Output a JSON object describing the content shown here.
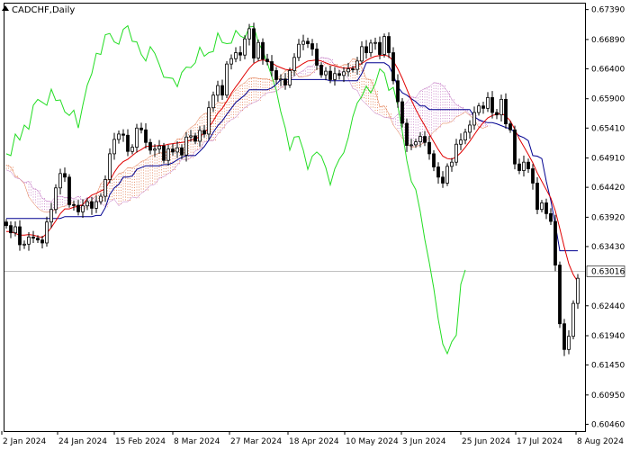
{
  "title": "CADCHF,Daily",
  "current_price": "0.63016",
  "colors": {
    "background": "#ffffff",
    "axis": "#000000",
    "candle": "#000000",
    "tenkan": "#e00000",
    "kijun": "#000090",
    "chikou": "#22dd22",
    "kumo_bull": "#e07040",
    "kumo_bear": "#c070c0",
    "price_line": "#c0c0c0"
  },
  "chart_data": {
    "type": "candlestick",
    "indicator": "Ichimoku Kinko Hyo",
    "symbol": "CADCHF",
    "timeframe": "Daily",
    "y_ticks": [
      "0.67390",
      "0.66890",
      "0.66400",
      "0.65900",
      "0.65410",
      "0.64910",
      "0.64420",
      "0.63920",
      "0.63430",
      "0.62440",
      "0.61940",
      "0.61450",
      "0.60950",
      "0.60460"
    ],
    "x_ticks": [
      "2 Jan 2024",
      "24 Jan 2024",
      "15 Feb 2024",
      "8 Mar 2024",
      "27 Mar 2024",
      "18 Apr 2024",
      "10 May 2024",
      "3 Jun 2024",
      "25 Jun 2024",
      "17 Jul 2024",
      "8 Aug 2024"
    ],
    "ylim": [
      0.60346,
      0.6749
    ],
    "price_line": 0.63016,
    "close": [
      0.6378,
      0.6366,
      0.6376,
      0.6346,
      0.6347,
      0.6359,
      0.6357,
      0.6354,
      0.6349,
      0.6384,
      0.6405,
      0.6441,
      0.6465,
      0.6459,
      0.6413,
      0.6412,
      0.6401,
      0.6411,
      0.6418,
      0.6407,
      0.6418,
      0.6427,
      0.6455,
      0.6498,
      0.6522,
      0.6531,
      0.6529,
      0.6502,
      0.6509,
      0.6541,
      0.6538,
      0.6517,
      0.6504,
      0.6506,
      0.6511,
      0.6487,
      0.6506,
      0.6501,
      0.6508,
      0.6496,
      0.6526,
      0.6528,
      0.6519,
      0.6537,
      0.6531,
      0.6575,
      0.6596,
      0.6612,
      0.6596,
      0.6648,
      0.6657,
      0.6667,
      0.6663,
      0.669,
      0.6707,
      0.6658,
      0.6684,
      0.6656,
      0.6652,
      0.6637,
      0.6622,
      0.6623,
      0.6613,
      0.6637,
      0.6659,
      0.6681,
      0.6686,
      0.6682,
      0.6673,
      0.6646,
      0.663,
      0.6636,
      0.6622,
      0.6632,
      0.6629,
      0.6635,
      0.664,
      0.6639,
      0.6653,
      0.6677,
      0.6667,
      0.6683,
      0.6684,
      0.6664,
      0.6694,
      0.6667,
      0.662,
      0.6585,
      0.6549,
      0.6512,
      0.6513,
      0.6518,
      0.6527,
      0.6517,
      0.6498,
      0.6476,
      0.6459,
      0.6449,
      0.6477,
      0.6484,
      0.6514,
      0.6521,
      0.6534,
      0.6546,
      0.6567,
      0.6578,
      0.6574,
      0.6592,
      0.6567,
      0.6563,
      0.6589,
      0.6548,
      0.6538,
      0.6481,
      0.647,
      0.6484,
      0.6473,
      0.6449,
      0.6405,
      0.6416,
      0.6398,
      0.6385,
      0.6312,
      0.6214,
      0.6171,
      0.6193,
      0.6248,
      0.629
    ],
    "tenkan_sen": [
      0.6368,
      0.6368,
      0.6365,
      0.6362,
      0.6362,
      0.6363,
      0.6362,
      0.636,
      0.6358,
      0.6365,
      0.6375,
      0.6386,
      0.6398,
      0.6406,
      0.6406,
      0.6409,
      0.641,
      0.6413,
      0.6423,
      0.6429,
      0.6432,
      0.6436,
      0.6439,
      0.6453,
      0.6467,
      0.6478,
      0.6485,
      0.6489,
      0.6495,
      0.6501,
      0.6505,
      0.651,
      0.6511,
      0.6511,
      0.6512,
      0.6512,
      0.6514,
      0.6515,
      0.6516,
      0.6517,
      0.6518,
      0.6521,
      0.6523,
      0.6527,
      0.6532,
      0.6542,
      0.6553,
      0.6566,
      0.6574,
      0.6586,
      0.6599,
      0.661,
      0.662,
      0.6631,
      0.6641,
      0.6649,
      0.6653,
      0.6655,
      0.6653,
      0.665,
      0.6645,
      0.6642,
      0.6639,
      0.6638,
      0.664,
      0.6644,
      0.6649,
      0.6653,
      0.6654,
      0.6655,
      0.6653,
      0.665,
      0.6647,
      0.6645,
      0.6643,
      0.6641,
      0.6641,
      0.6642,
      0.6645,
      0.6649,
      0.6654,
      0.6658,
      0.6661,
      0.6662,
      0.6663,
      0.6661,
      0.6653,
      0.664,
      0.6624,
      0.6606,
      0.6588,
      0.6572,
      0.6558,
      0.6545,
      0.6531,
      0.6518,
      0.6505,
      0.6494,
      0.649,
      0.6489,
      0.6493,
      0.65,
      0.6509,
      0.6519,
      0.653,
      0.6541,
      0.655,
      0.6558,
      0.6562,
      0.6564,
      0.6566,
      0.6561,
      0.6553,
      0.6539,
      0.6523,
      0.651,
      0.6497,
      0.6483,
      0.6466,
      0.6452,
      0.6438,
      0.6424,
      0.6403,
      0.6373,
      0.6342,
      0.6314,
      0.6296,
      0.6284
    ],
    "kijun_sen": [
      0.639,
      0.639,
      0.639,
      0.639,
      0.639,
      0.639,
      0.639,
      0.639,
      0.639,
      0.639,
      0.639,
      0.639,
      0.639,
      0.6393,
      0.6393,
      0.6393,
      0.6393,
      0.6393,
      0.6393,
      0.6393,
      0.6395,
      0.6395,
      0.6408,
      0.643,
      0.6441,
      0.6447,
      0.6459,
      0.6459,
      0.6461,
      0.6472,
      0.6475,
      0.6478,
      0.6478,
      0.6478,
      0.6478,
      0.648,
      0.648,
      0.6483,
      0.6488,
      0.6492,
      0.6495,
      0.6495,
      0.6495,
      0.6502,
      0.651,
      0.6521,
      0.6534,
      0.6545,
      0.6553,
      0.6564,
      0.6574,
      0.6584,
      0.659,
      0.6596,
      0.6605,
      0.6605,
      0.6605,
      0.6605,
      0.6605,
      0.6608,
      0.6614,
      0.6622,
      0.6622,
      0.6622,
      0.6622,
      0.6622,
      0.6622,
      0.6622,
      0.6622,
      0.6622,
      0.6622,
      0.6622,
      0.662,
      0.662,
      0.662,
      0.662,
      0.662,
      0.662,
      0.662,
      0.6632,
      0.665,
      0.665,
      0.665,
      0.665,
      0.665,
      0.6645,
      0.663,
      0.661,
      0.66,
      0.6596,
      0.659,
      0.6585,
      0.6578,
      0.6578,
      0.6572,
      0.6572,
      0.6572,
      0.6572,
      0.6572,
      0.6572,
      0.6572,
      0.6572,
      0.6572,
      0.6572,
      0.656,
      0.6555,
      0.6552,
      0.655,
      0.655,
      0.6548,
      0.6545,
      0.6542,
      0.654,
      0.6534,
      0.6528,
      0.6525,
      0.652,
      0.6495,
      0.6494,
      0.649,
      0.6452,
      0.642,
      0.638,
      0.6336,
      0.6336,
      0.6336,
      0.6336,
      0.6336
    ],
    "senkou_span_a": [
      0.6548,
      0.6551,
      0.6551,
      0.6554,
      0.6554,
      0.6559,
      0.6555,
      0.6554,
      0.6549,
      0.6549,
      0.6548,
      0.6541,
      0.6531,
      0.6523,
      0.6516,
      0.6512,
      0.6502,
      0.6496,
      0.6499,
      0.6487,
      0.6479,
      0.6476,
      0.6461,
      0.6456,
      0.6448,
      0.6426,
      0.6416,
      0.6407,
      0.6402,
      0.64,
      0.6402,
      0.6404,
      0.6409,
      0.641,
      0.6417,
      0.6416,
      0.6407,
      0.6405,
      0.641,
      0.6421,
      0.6429,
      0.6448,
      0.6455,
      0.6454,
      0.6456,
      0.6465,
      0.6467,
      0.6475,
      0.6474,
      0.6479,
      0.6485,
      0.6488,
      0.6494,
      0.6497,
      0.6499,
      0.6501,
      0.6502,
      0.6513,
      0.6523,
      0.6523,
      0.6535,
      0.6542,
      0.6547,
      0.6559,
      0.6565,
      0.6567,
      0.6576,
      0.6584,
      0.6583,
      0.6585,
      0.6596,
      0.6605,
      0.6612,
      0.6617,
      0.6624,
      0.6625,
      0.6624,
      0.6623,
      0.6623,
      0.662,
      0.6624,
      0.6628,
      0.6637,
      0.6639,
      0.6637,
      0.6626,
      0.6627,
      0.6628,
      0.6633,
      0.664,
      0.6641,
      0.665,
      0.6643,
      0.6648,
      0.6643,
      0.6647,
      0.6647,
      0.6657,
      0.6654,
      0.6642,
      0.6623,
      0.6622,
      0.6603,
      0.6577,
      0.6578,
      0.6565,
      0.6546,
      0.6536,
      0.6524,
      0.6515,
      0.6509,
      0.651,
      0.6513,
      0.6517,
      0.6526,
      0.6535,
      0.6541,
      0.6549,
      0.6549,
      0.6552,
      0.656,
      0.6563,
      0.6568,
      0.6562,
      0.6556,
      0.6542,
      0.6541,
      0.6544
    ],
    "senkou_span_b": [
      0.6519,
      0.6522,
      0.6525,
      0.6521,
      0.6521,
      0.6512,
      0.6512,
      0.6516,
      0.6518,
      0.651,
      0.6504,
      0.6493,
      0.6495,
      0.6493,
      0.6481,
      0.6485,
      0.6484,
      0.6488,
      0.6479,
      0.6474,
      0.6471,
      0.6468,
      0.6458,
      0.6456,
      0.645,
      0.6452,
      0.644,
      0.6437,
      0.6424,
      0.6419,
      0.6418,
      0.6427,
      0.6427,
      0.6425,
      0.6425,
      0.6423,
      0.6427,
      0.642,
      0.6425,
      0.6425,
      0.6419,
      0.6417,
      0.6409,
      0.6418,
      0.6422,
      0.6411,
      0.6418,
      0.6418,
      0.6426,
      0.6424,
      0.6432,
      0.6437,
      0.6445,
      0.6447,
      0.6457,
      0.646,
      0.6465,
      0.647,
      0.6479,
      0.6489,
      0.6488,
      0.6491,
      0.6503,
      0.6506,
      0.6518,
      0.6519,
      0.652,
      0.6531,
      0.6539,
      0.6549,
      0.6555,
      0.6559,
      0.6568,
      0.6575,
      0.658,
      0.6584,
      0.6587,
      0.6595,
      0.66,
      0.6601,
      0.6603,
      0.6608,
      0.6613,
      0.6622,
      0.6628,
      0.6633,
      0.6637,
      0.6644,
      0.6644,
      0.6654,
      0.6659,
      0.6658,
      0.6656,
      0.6646,
      0.6638,
      0.6631,
      0.6624,
      0.6607,
      0.6604,
      0.6588,
      0.6581,
      0.6573,
      0.6566,
      0.6563,
      0.6559,
      0.6558,
      0.6557,
      0.6564,
      0.6575,
      0.6584,
      0.6593,
      0.6592,
      0.6603,
      0.6607,
      0.661,
      0.6617,
      0.6616,
      0.6612,
      0.6603,
      0.6589,
      0.658,
      0.6576,
      0.6571,
      0.6564,
      0.6562,
      0.6553,
      0.655,
      0.6545
    ],
    "chikou_span": [
      0.6498,
      0.6495,
      0.6531,
      0.6521,
      0.6546,
      0.6539,
      0.6579,
      0.6589,
      0.6584,
      0.6579,
      0.6606,
      0.6587,
      0.6588,
      0.6568,
      0.6562,
      0.6571,
      0.6541,
      0.6579,
      0.6613,
      0.6632,
      0.6666,
      0.6664,
      0.6697,
      0.6699,
      0.6685,
      0.6681,
      0.6706,
      0.6712,
      0.6686,
      0.6685,
      0.6664,
      0.6653,
      0.6677,
      0.6666,
      0.6647,
      0.6626,
      0.6625,
      0.6624,
      0.661,
      0.6634,
      0.6643,
      0.6642,
      0.665,
      0.6676,
      0.6661,
      0.6667,
      0.6669,
      0.67,
      0.6684,
      0.6682,
      0.6683,
      0.6704,
      0.6695,
      0.6691,
      0.671,
      0.6711,
      0.6684,
      0.667,
      0.665,
      0.6627,
      0.6604,
      0.6568,
      0.6541,
      0.6504,
      0.6526,
      0.6527,
      0.6504,
      0.6472,
      0.6494,
      0.6501,
      0.6494,
      0.6475,
      0.6446,
      0.6473,
      0.6489,
      0.65,
      0.6525,
      0.656,
      0.6583,
      0.6594,
      0.6611,
      0.66,
      0.6615,
      0.664,
      0.6633,
      0.6604,
      0.6609,
      0.6579,
      0.6535,
      0.6487,
      0.6452,
      0.6438,
      0.6401,
      0.6355,
      0.6316,
      0.6273,
      0.6221,
      0.618,
      0.6164,
      0.6184,
      0.6195,
      0.628,
      0.6304
    ]
  }
}
